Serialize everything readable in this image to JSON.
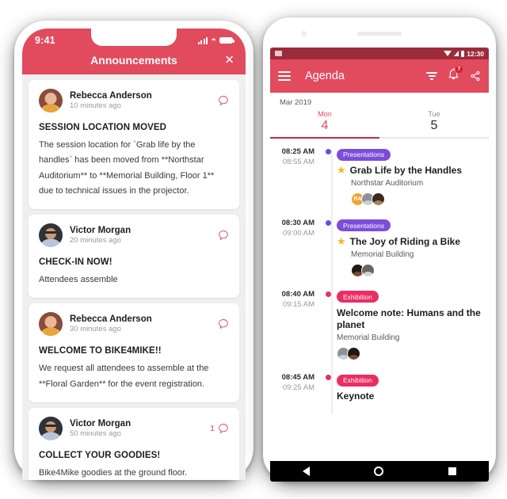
{
  "ios": {
    "status": {
      "time": "9:41"
    },
    "header": {
      "title": "Announcements",
      "close_icon": "close-icon"
    },
    "announcements": [
      {
        "author": "Rebecca Anderson",
        "time": "10 minutes ago",
        "title": "SESSION LOCATION MOVED",
        "body": "The session location for `Grab life by the handles` has been moved from **Northstar Auditorium** to **Memorial Building, Floor 1** due to technical issues in the projector.",
        "comment_count": "",
        "avatar": "rebecca"
      },
      {
        "author": "Victor Morgan",
        "time": "20 minutes ago",
        "title": "CHECK-IN NOW!",
        "body": "Attendees assemble",
        "comment_count": "",
        "avatar": "victor"
      },
      {
        "author": "Rebecca Anderson",
        "time": "30 minutes ago",
        "title": "WELCOME TO BIKE4MIKE!!",
        "body": "We request all attendees to assemble at the **Floral Garden** for the event registration.",
        "comment_count": "",
        "avatar": "rebecca"
      },
      {
        "author": "Victor Morgan",
        "time": "50 minutes ago",
        "title": "COLLECT YOUR GOODIES!",
        "body": "Bike4Mike goodies at the ground floor.",
        "comment_count": "1",
        "avatar": "victor"
      }
    ]
  },
  "android": {
    "status": {
      "time": "12:30"
    },
    "appbar": {
      "title": "Agenda",
      "menu_icon": "hamburger-menu-icon",
      "filter_icon": "filter-icon",
      "bell_icon": "notification-bell-icon",
      "bell_badge": "7",
      "share_icon": "share-icon"
    },
    "month": "Mar 2019",
    "dates": [
      {
        "dow": "Mon",
        "num": "4",
        "active": true
      },
      {
        "dow": "Tue",
        "num": "5",
        "active": false
      }
    ],
    "agenda": [
      {
        "start": "08:25 AM",
        "end": "08:55 AM",
        "chip": "Presentations",
        "chip_color": "#7c4ddb",
        "dot_color": "#6d4ddb",
        "starred": true,
        "title": "Grab Life by the Handles",
        "location": "Northstar Auditorium",
        "avatars": [
          "RA",
          "",
          ""
        ]
      },
      {
        "start": "08:30 AM",
        "end": "09:00 AM",
        "chip": "Presentations",
        "chip_color": "#7c4ddb",
        "dot_color": "#6d4ddb",
        "starred": true,
        "title": "The Joy of Riding a Bike",
        "location": "Memorial Building",
        "avatars": [
          "",
          ""
        ]
      },
      {
        "start": "08:40 AM",
        "end": "09:15 AM",
        "chip": "Exhibition",
        "chip_color": "#ec2d63",
        "dot_color": "#ec2d63",
        "starred": false,
        "title": "Welcome note: Humans and the planet",
        "location": "Memorial Building",
        "avatars": [
          "",
          ""
        ]
      },
      {
        "start": "08:45 AM",
        "end": "09:25 AM",
        "chip": "Exhibition",
        "chip_color": "#ec2d63",
        "dot_color": "#ec2d63",
        "starred": false,
        "title": "Keynote",
        "location": "",
        "avatars": []
      }
    ],
    "navbar": {
      "back_icon": "back-icon",
      "home_icon": "home-icon",
      "recents_icon": "recents-icon"
    }
  },
  "colors": {
    "brand_red": "#e24a5e",
    "status_dark_red": "#9c2c3c",
    "purple": "#7c4ddb",
    "pink": "#ec2d63",
    "star_yellow": "#f5b622"
  }
}
